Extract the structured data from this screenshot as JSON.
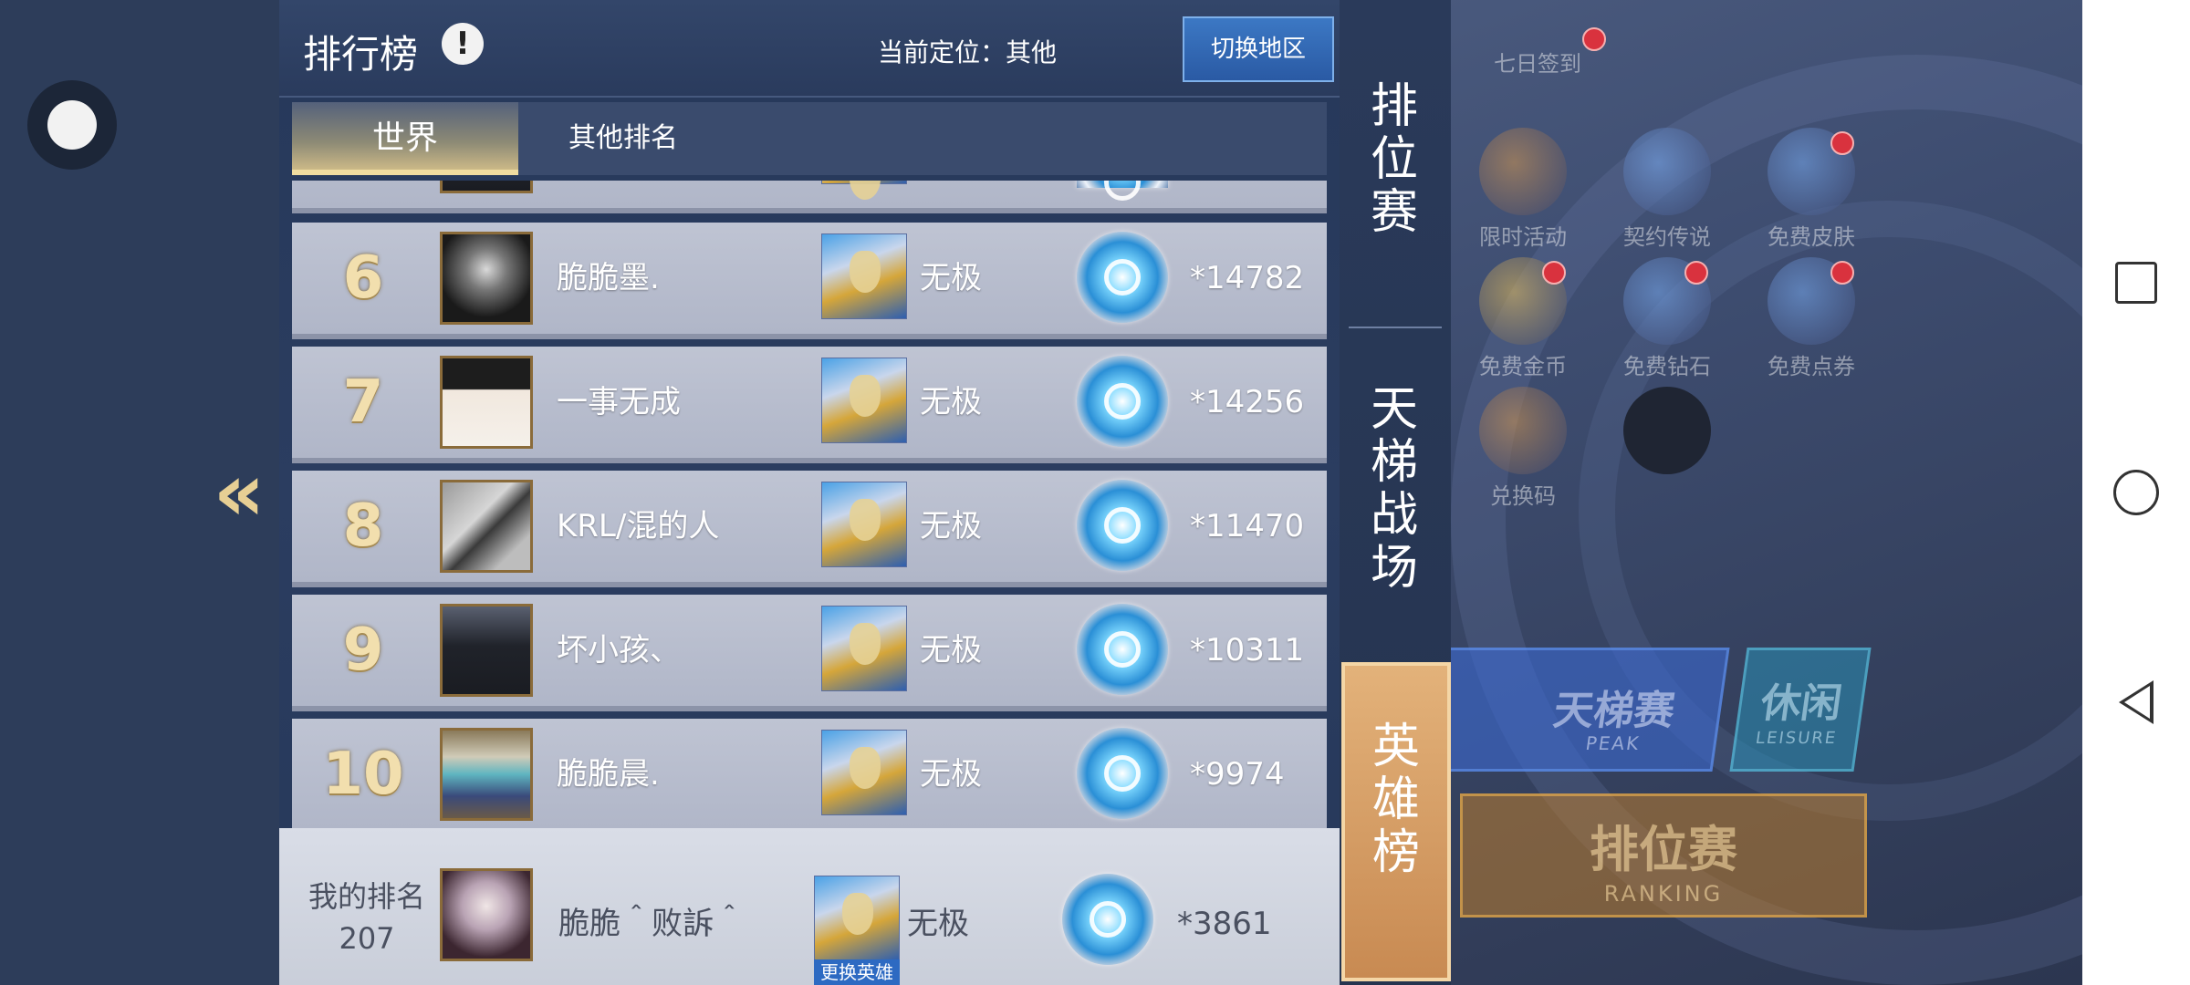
{
  "panel": {
    "title": "排行榜",
    "info_glyph": "!",
    "location_label": "当前定位：其他",
    "switch_region_label": "切换地区",
    "tabs": [
      {
        "label": "世界",
        "active": true
      },
      {
        "label": "其他排名",
        "active": false
      }
    ]
  },
  "ranking_rows": [
    {
      "rank": "6",
      "name": "脆脆墨.",
      "hero": "无极",
      "score": "*14782",
      "avatar": "dark-avatar"
    },
    {
      "rank": "7",
      "name": "一事无成",
      "hero": "无极",
      "score": "*14256",
      "avatar": "anime-avatar"
    },
    {
      "rank": "8",
      "name": "KRL/混的人",
      "hero": "无极",
      "score": "*11470",
      "avatar": "rock-avatar"
    },
    {
      "rank": "9",
      "name": "坏小孩、",
      "hero": "无极",
      "score": "*10311",
      "avatar": "girl-avatar"
    },
    {
      "rank": "10",
      "name": "脆脆晨.",
      "hero": "无极",
      "score": "*9974",
      "avatar": "lion-avatar"
    }
  ],
  "my_rank": {
    "label": "我的排名",
    "rank": "207",
    "name": "脆脆＾败訴＾",
    "hero": "无极",
    "score": "*3861",
    "change_hero_label": "更换英雄"
  },
  "side_tabs": [
    {
      "label": "排位赛",
      "active": false
    },
    {
      "label": "天梯战场",
      "active": false
    },
    {
      "label": "英雄榜",
      "active": true
    }
  ],
  "background_ui": {
    "top_icons": [
      "七日签到"
    ],
    "icons": [
      "限时活动",
      "契约传说",
      "免费皮肤",
      "免费金币",
      "免费钻石",
      "免费点券",
      "兑换码"
    ],
    "peak_title": "天梯赛",
    "peak_sub": "PEAK",
    "leisure_title": "休闲",
    "leisure_sub": "LEISURE",
    "ranking_title": "排位赛",
    "ranking_sub": "RANKING"
  },
  "colors": {
    "panel_bg": "#2b3d60",
    "row_bg": "#b0b6c8",
    "rank_gold": "#f2dfae",
    "active_side_tab": "#d69c62",
    "switch_button": "#2a5aa4"
  },
  "icons": {
    "collapse": "double-chevron-left-icon",
    "info": "exclamation-icon",
    "rank_badge": "diamond-rank-badge-icon"
  }
}
